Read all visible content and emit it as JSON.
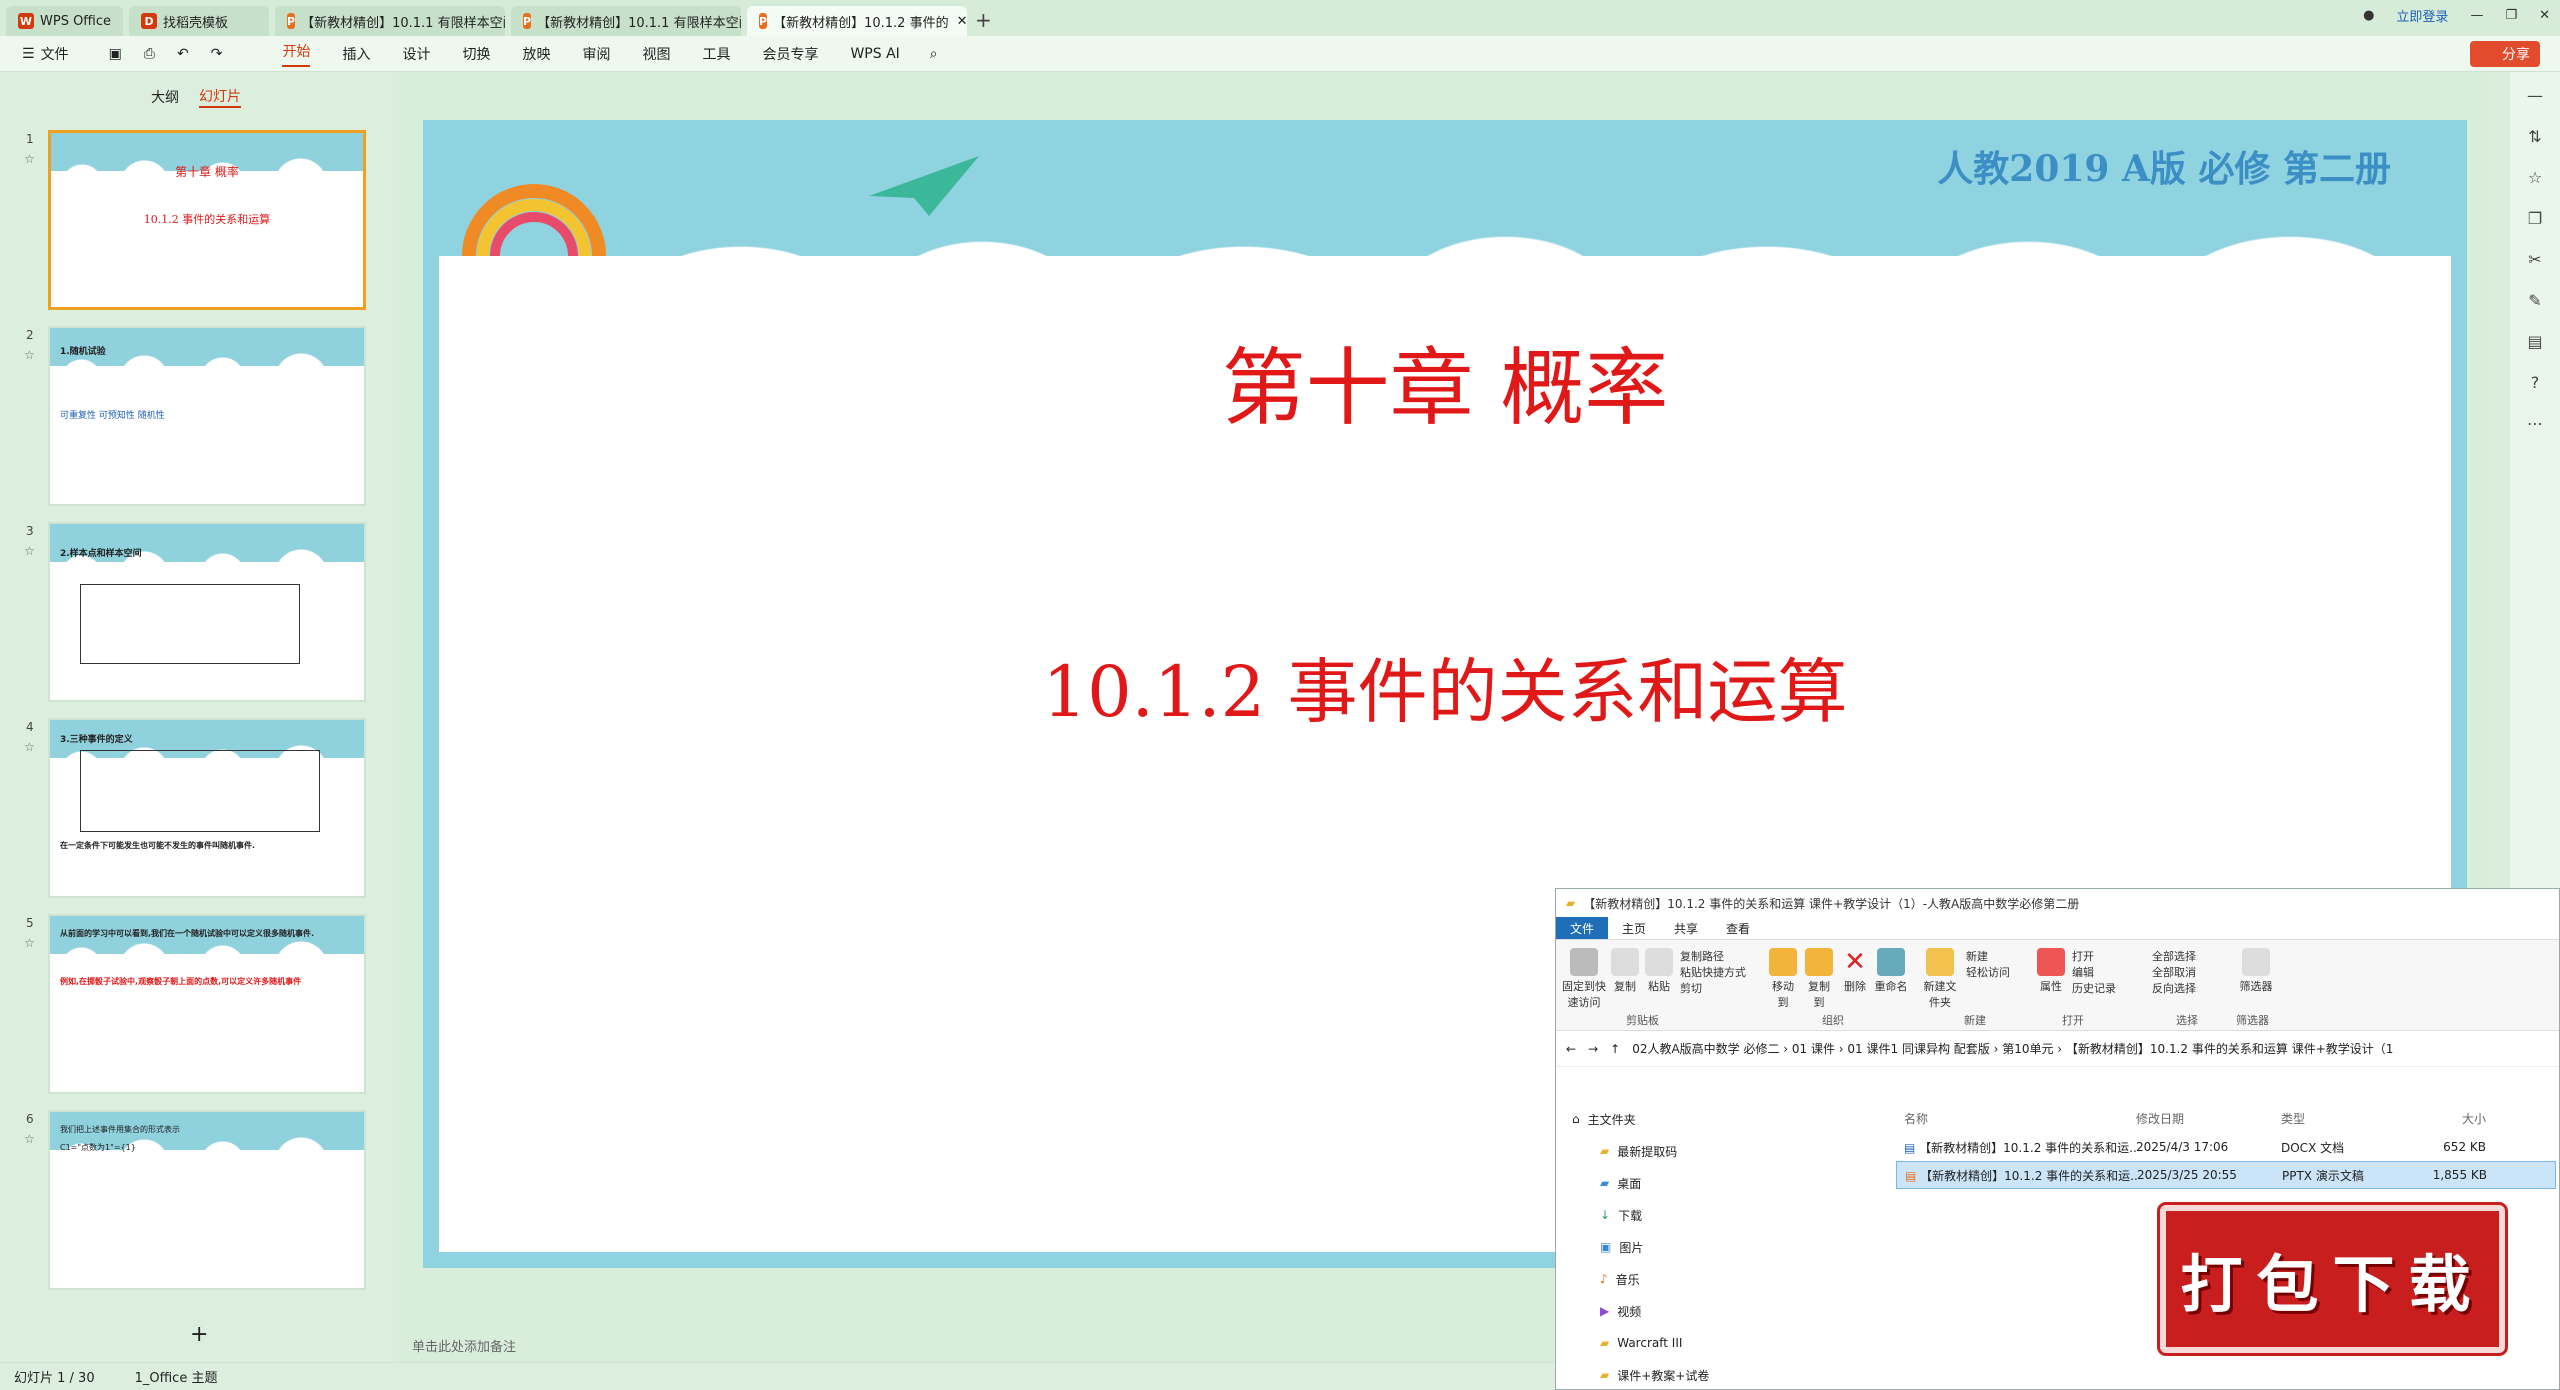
{
  "tabs": [
    {
      "label": "WPS Office",
      "color": "#d4380d"
    },
    {
      "label": "找稻壳模板",
      "color": "#d4380d"
    },
    {
      "label": "【新教材精创】10.1.1 有限样本空间",
      "color": "#e8701d"
    },
    {
      "label": "【新教材精创】10.1.1 有限样本空间",
      "color": "#e8701d"
    },
    {
      "label": "【新教材精创】10.1.2 事件的",
      "color": "#e8701d"
    }
  ],
  "window": {
    "login": "立即登录"
  },
  "toolbar": {
    "file": "文件",
    "menus": [
      "开始",
      "插入",
      "设计",
      "切换",
      "放映",
      "审阅",
      "视图",
      "工具",
      "会员专享",
      "WPS AI"
    ],
    "share": "分享"
  },
  "leftpanel": {
    "outline_tab": "大纲",
    "slides_tab": "幻灯片"
  },
  "thumbs": [
    {
      "num": "1",
      "line1": "第十章 概率",
      "line2": "10.1.2 事件的关系和运算"
    },
    {
      "num": "2",
      "line1": "1.随机试验",
      "line2": "可重复性   可预知性   随机性"
    },
    {
      "num": "3",
      "line1": "2.样本点和样本空间",
      "line2": ""
    },
    {
      "num": "4",
      "line1": "3.三种事件的定义",
      "line2": "在一定条件下可能发生也可能不发生的事件叫随机事件."
    },
    {
      "num": "5",
      "line1": "从前面的学习中可以看到,我们在一个随机试验中可以定义很多随机事件.",
      "line2": "例如,在掷骰子试验中,观察骰子朝上面的点数,可以定义许多随机事件"
    },
    {
      "num": "6",
      "line1": "我们把上述事件用集合的形式表示",
      "line2": "C1=\"点数为1\"={1}"
    }
  ],
  "slide": {
    "corner": "人教2019 A版 必修 第二册",
    "title": "第十章 概率",
    "subtitle": "10.1.2 事件的关系和运算"
  },
  "notes": "单击此处添加备注",
  "status": {
    "page": "幻灯片 1 / 30",
    "theme": "1_Office 主题"
  },
  "explorer": {
    "title": "【新教材精创】10.1.2 事件的关系和运算 课件+教学设计（1）-人教A版高中数学必修第二册",
    "tabs": [
      "文件",
      "主页",
      "共享",
      "查看"
    ],
    "ribbon": {
      "pin": "固定到快速访问",
      "copy": "复制",
      "paste": "粘贴",
      "copypath": "复制路径",
      "pasteshortcut": "粘贴快捷方式",
      "cut": "剪切",
      "clipboard": "剪贴板",
      "moveto": "移动到",
      "copyto": "复制到",
      "delete": "删除",
      "rename": "重命名",
      "organize": "组织",
      "newfolder": "新建文件夹",
      "newitem": "新建",
      "easyaccess": "轻松访问",
      "new": "新建",
      "properties": "属性",
      "open": "打开",
      "edit": "编辑",
      "history": "历史记录",
      "opengroup": "打开",
      "selectall": "全部选择",
      "selectnone": "全部取消",
      "invert": "反向选择",
      "select": "选择",
      "filter": "筛选器",
      "filtergroup": "筛选器"
    },
    "address": "02人教A版高中数学 必修二  ›  01 课件  ›  01 课件1 同课异构 配套版  ›  第10单元  ›  【新教材精创】10.1.2 事件的关系和运算 课件+教学设计（1",
    "nav": [
      "主文件夹",
      "最新提取码",
      "桌面",
      "下载",
      "图片",
      "音乐",
      "视频",
      "Warcraft III",
      "课件+教案+试卷"
    ],
    "headers": [
      "名称",
      "修改日期",
      "类型",
      "大小"
    ],
    "files": [
      {
        "name": "【新教材精创】10.1.2 事件的关系和运...",
        "date": "2025/4/3 17:06",
        "type": "DOCX 文档",
        "size": "652 KB"
      },
      {
        "name": "【新教材精创】10.1.2 事件的关系和运...",
        "date": "2025/3/25 20:55",
        "type": "PPTX 演示文稿",
        "size": "1,855 KB"
      }
    ]
  },
  "banner": "打包下载"
}
